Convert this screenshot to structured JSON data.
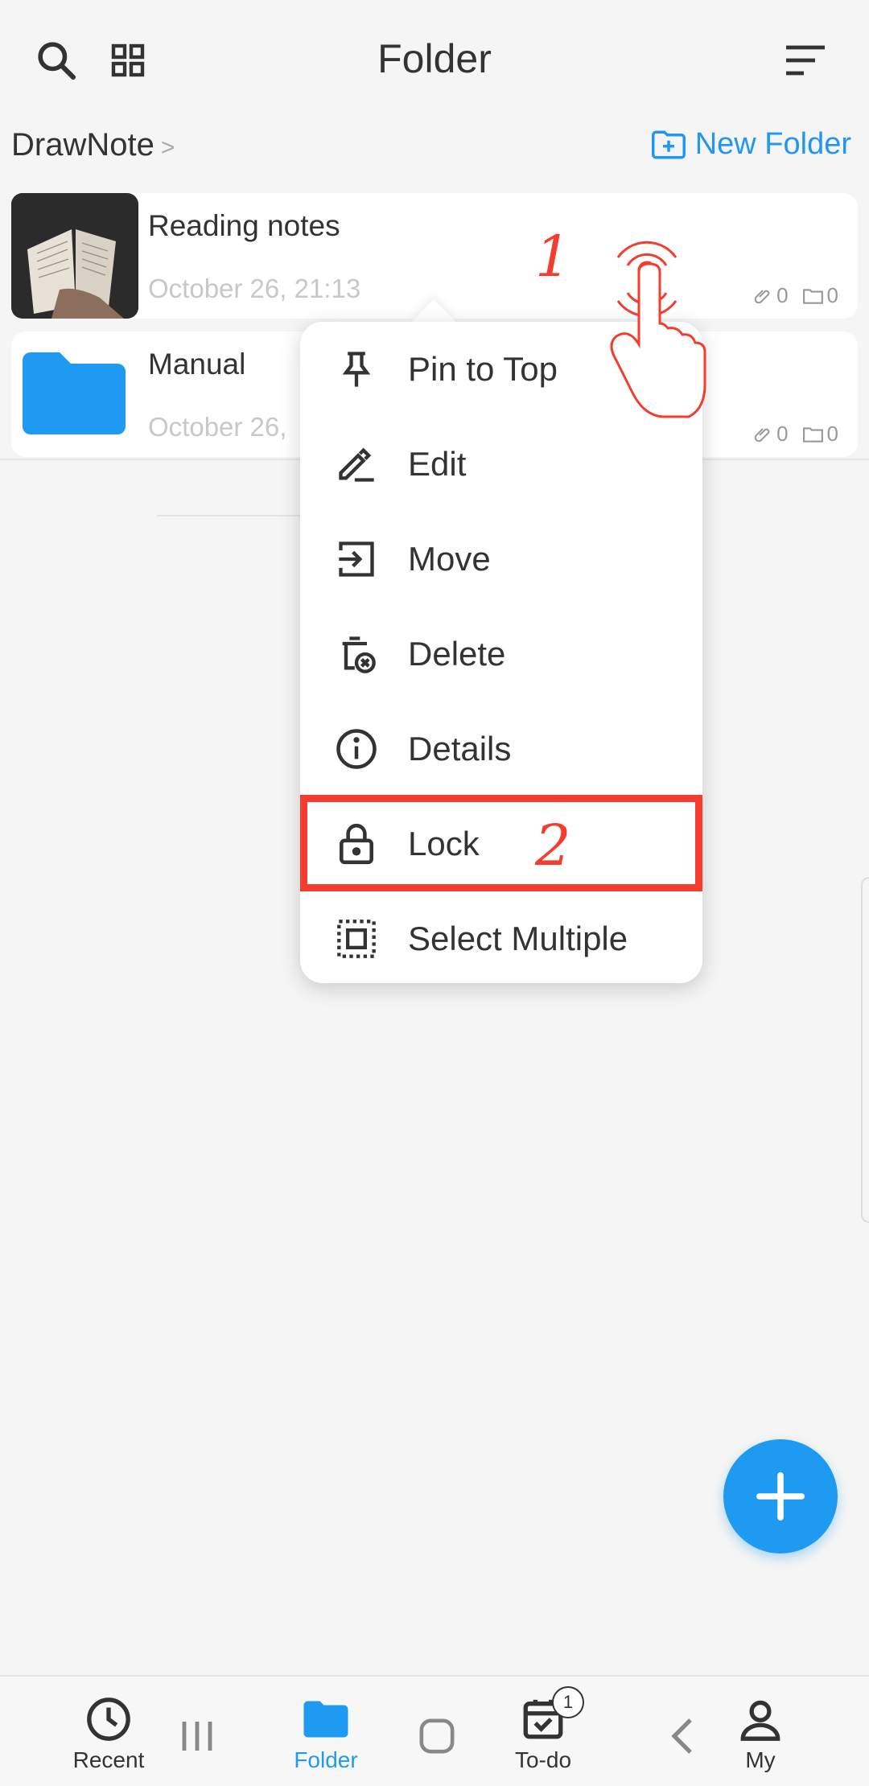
{
  "header": {
    "title": "Folder",
    "icons": [
      "search-icon",
      "grid-view-icon",
      "sort-icon"
    ]
  },
  "breadcrumb": {
    "root": "DrawNote",
    "separator": ">"
  },
  "new_folder_label": "New Folder",
  "items": [
    {
      "name": "Reading notes",
      "date": "October 26, 21:13",
      "attachments": "0",
      "subfolders": "0"
    },
    {
      "name": "Manual",
      "date": "October 26,",
      "attachments": "0",
      "subfolders": "0"
    }
  ],
  "context_menu": {
    "items": [
      {
        "label": "Pin to Top",
        "icon": "pin-icon"
      },
      {
        "label": "Edit",
        "icon": "edit-icon"
      },
      {
        "label": "Move",
        "icon": "move-icon"
      },
      {
        "label": "Delete",
        "icon": "delete-icon"
      },
      {
        "label": "Details",
        "icon": "info-icon"
      },
      {
        "label": "Lock",
        "icon": "lock-icon"
      },
      {
        "label": "Select Multiple",
        "icon": "select-multiple-icon"
      }
    ]
  },
  "annotations": {
    "step1": "1",
    "step2": "2"
  },
  "bottom_nav": {
    "items": [
      {
        "label": "Recent",
        "icon": "clock-icon"
      },
      {
        "label": "Folder",
        "icon": "folder-icon"
      },
      {
        "label": "To-do",
        "icon": "todo-icon",
        "badge": "1"
      },
      {
        "label": "My",
        "icon": "person-icon"
      }
    ],
    "active": "Folder"
  },
  "colors": {
    "accent": "#1e9bf0",
    "annotation": "#f43c2f",
    "background": "#f5f5f5"
  }
}
